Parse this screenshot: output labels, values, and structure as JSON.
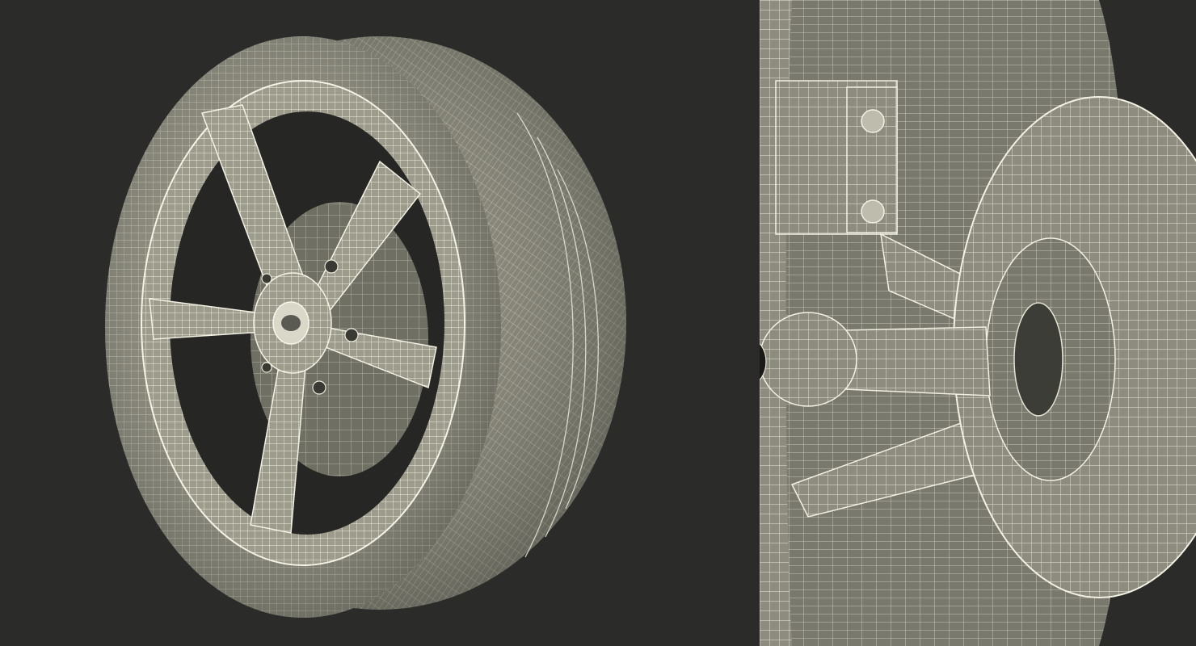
{
  "scene": {
    "background_color": "#2b2b2a",
    "wire_color": "#e7e6d6",
    "shade_color": "#8a8a7c",
    "left_view": {
      "subject": "wheel-with-tire",
      "spoke_count": 5,
      "lug_nut_count": 5
    },
    "right_view": {
      "subject": "suspension-hub-closeup"
    }
  }
}
